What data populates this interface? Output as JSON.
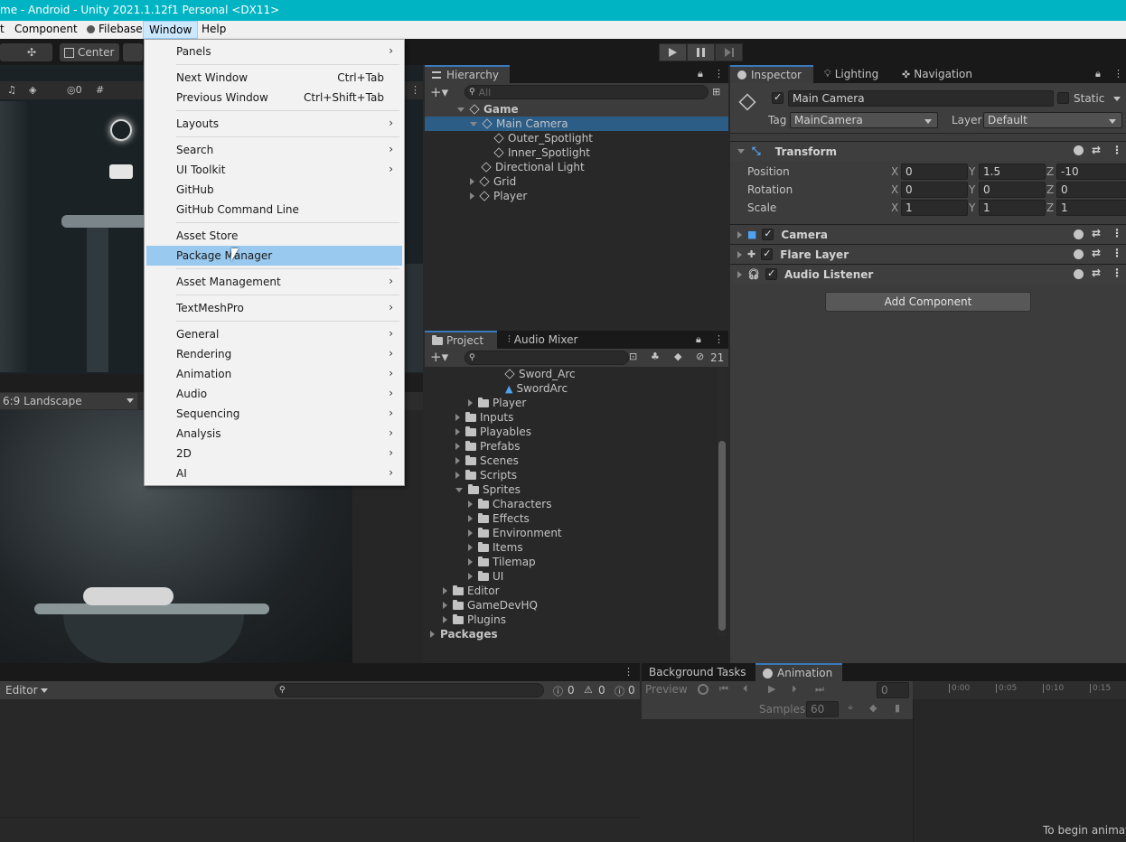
{
  "titlebar": {
    "text": "me - Android - Unity 2021.1.12f1 Personal <DX11>"
  },
  "menubar": {
    "items": [
      "t",
      "Component",
      "Filebase",
      "Window",
      "Help"
    ]
  },
  "toolbar": {
    "center_label": "Center"
  },
  "window_menu": {
    "groups": [
      [
        {
          "label": "Panels",
          "sub": true
        }
      ],
      [
        {
          "label": "Next Window",
          "shortcut": "Ctrl+Tab"
        },
        {
          "label": "Previous Window",
          "shortcut": "Ctrl+Shift+Tab"
        }
      ],
      [
        {
          "label": "Layouts",
          "sub": true
        }
      ],
      [
        {
          "label": "Search",
          "sub": true
        },
        {
          "label": "UI Toolkit",
          "sub": true
        },
        {
          "label": "GitHub"
        },
        {
          "label": "GitHub Command Line"
        }
      ],
      [
        {
          "label": "Asset Store"
        },
        {
          "label": "Package Manager",
          "highlighted": true
        }
      ],
      [
        {
          "label": "Asset Management",
          "sub": true
        }
      ],
      [
        {
          "label": "TextMeshPro",
          "sub": true
        }
      ],
      [
        {
          "label": "General",
          "sub": true
        },
        {
          "label": "Rendering",
          "sub": true
        },
        {
          "label": "Animation",
          "sub": true
        },
        {
          "label": "Audio",
          "sub": true
        },
        {
          "label": "Sequencing",
          "sub": true
        },
        {
          "label": "Analysis",
          "sub": true
        },
        {
          "label": "2D",
          "sub": true
        },
        {
          "label": "AI",
          "sub": true
        }
      ]
    ]
  },
  "hierarchy": {
    "tab": "Hierarchy",
    "search_placeholder": "All",
    "items": [
      {
        "label": "Game",
        "indent": 0,
        "expanded": true,
        "scene": true
      },
      {
        "label": "Main Camera",
        "indent": 1,
        "expanded": true,
        "selected": true
      },
      {
        "label": "Outer_Spotlight",
        "indent": 2
      },
      {
        "label": "Inner_Spotlight",
        "indent": 2
      },
      {
        "label": "Directional Light",
        "indent": 1
      },
      {
        "label": "Grid",
        "indent": 1,
        "collapsed": true
      },
      {
        "label": "Player",
        "indent": 1,
        "collapsed": true
      }
    ]
  },
  "project": {
    "tabs": [
      "Project",
      "Audio Mixer"
    ],
    "hidden_count": "21",
    "items": [
      {
        "label": "Sword_Arc",
        "indent": 5,
        "kind": "anim"
      },
      {
        "label": "SwordArc",
        "indent": 5,
        "kind": "clip"
      },
      {
        "label": "Player",
        "indent": 3,
        "kind": "folder",
        "collapsed": true
      },
      {
        "label": "Inputs",
        "indent": 2,
        "kind": "folder",
        "collapsed": true
      },
      {
        "label": "Playables",
        "indent": 2,
        "kind": "folder",
        "collapsed": true
      },
      {
        "label": "Prefabs",
        "indent": 2,
        "kind": "folder",
        "collapsed": true
      },
      {
        "label": "Scenes",
        "indent": 2,
        "kind": "folder",
        "collapsed": true
      },
      {
        "label": "Scripts",
        "indent": 2,
        "kind": "folder",
        "collapsed": true
      },
      {
        "label": "Sprites",
        "indent": 2,
        "kind": "folder",
        "expanded": true
      },
      {
        "label": "Characters",
        "indent": 3,
        "kind": "folder",
        "collapsed": true
      },
      {
        "label": "Effects",
        "indent": 3,
        "kind": "folder",
        "collapsed": true
      },
      {
        "label": "Environment",
        "indent": 3,
        "kind": "folder",
        "collapsed": true
      },
      {
        "label": "Items",
        "indent": 3,
        "kind": "folder",
        "collapsed": true
      },
      {
        "label": "Tilemap",
        "indent": 3,
        "kind": "folder",
        "collapsed": true
      },
      {
        "label": "UI",
        "indent": 3,
        "kind": "folder",
        "collapsed": true
      },
      {
        "label": "Editor",
        "indent": 1,
        "kind": "folder",
        "collapsed": true
      },
      {
        "label": "GameDevHQ",
        "indent": 1,
        "kind": "folder",
        "collapsed": true
      },
      {
        "label": "Plugins",
        "indent": 1,
        "kind": "folder",
        "collapsed": true
      },
      {
        "label": "Packages",
        "indent": 0,
        "kind": "root",
        "collapsed": true
      }
    ]
  },
  "inspector": {
    "tabs": [
      "Inspector",
      "Lighting",
      "Navigation"
    ],
    "object_name": "Main Camera",
    "static_label": "Static",
    "tag_label": "Tag",
    "tag_value": "MainCamera",
    "layer_label": "Layer",
    "layer_value": "Default",
    "transform": {
      "title": "Transform",
      "rows": [
        {
          "label": "Position",
          "x": "0",
          "y": "1.5",
          "z": "-10"
        },
        {
          "label": "Rotation",
          "x": "0",
          "y": "0",
          "z": "0"
        },
        {
          "label": "Scale",
          "x": "1",
          "y": "1",
          "z": "1"
        }
      ]
    },
    "components": [
      "Camera",
      "Flare Layer",
      "Audio Listener"
    ],
    "add_component": "Add Component"
  },
  "game_view": {
    "aspect": "6:9 Landscape"
  },
  "console": {
    "editor_label": "Editor",
    "counts": [
      "0",
      "0",
      "0"
    ]
  },
  "animation": {
    "tabs": [
      "Background Tasks",
      "Animation"
    ],
    "preview": "Preview",
    "frame": "0",
    "samples_label": "Samples",
    "samples": "60",
    "ticks": [
      "0:00",
      "0:05",
      "0:10",
      "0:15"
    ],
    "hint": "To begin animati"
  },
  "colors": {
    "titlebar": "#00b4c3",
    "menu_highlight": "#99c9ef",
    "selection": "#2c5d87"
  }
}
